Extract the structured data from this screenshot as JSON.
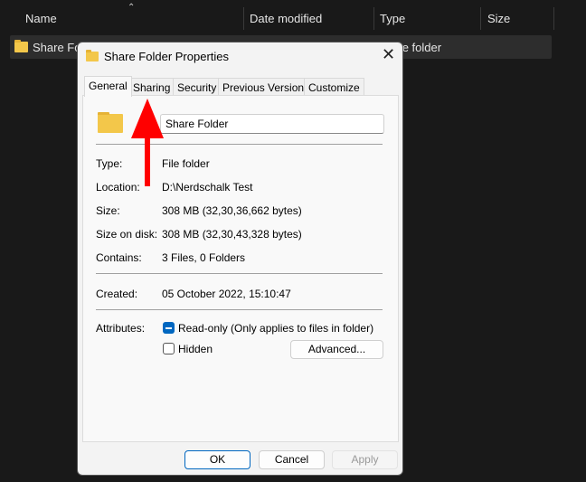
{
  "explorer": {
    "columns": [
      "Name",
      "Date modified",
      "Type",
      "Size"
    ],
    "row": {
      "name": "Share Folder",
      "type": "File folder"
    }
  },
  "dialog": {
    "title": "Share Folder Properties",
    "tabs": [
      "General",
      "Sharing",
      "Security",
      "Previous Versions",
      "Customize"
    ],
    "active_tab": "General",
    "folder_name": "Share Folder",
    "fields": [
      {
        "label": "Type:",
        "value": "File folder"
      },
      {
        "label": "Location:",
        "value": "D:\\Nerdschalk Test"
      },
      {
        "label": "Size:",
        "value": "308 MB (32,30,36,662 bytes)"
      },
      {
        "label": "Size on disk:",
        "value": "308 MB (32,30,43,328 bytes)"
      },
      {
        "label": "Contains:",
        "value": "3 Files, 0 Folders"
      }
    ],
    "created": {
      "label": "Created:",
      "value": "05 October 2022, 15:10:47"
    },
    "attributes": {
      "label": "Attributes:",
      "readonly": "Read-only (Only applies to files in folder)",
      "readonly_state": "indeterminate",
      "hidden": "Hidden",
      "hidden_checked": false,
      "advanced": "Advanced..."
    },
    "buttons": {
      "ok": "OK",
      "cancel": "Cancel",
      "apply": "Apply"
    }
  },
  "colors": {
    "accent": "#0067c0",
    "arrow": "#ff0000"
  }
}
